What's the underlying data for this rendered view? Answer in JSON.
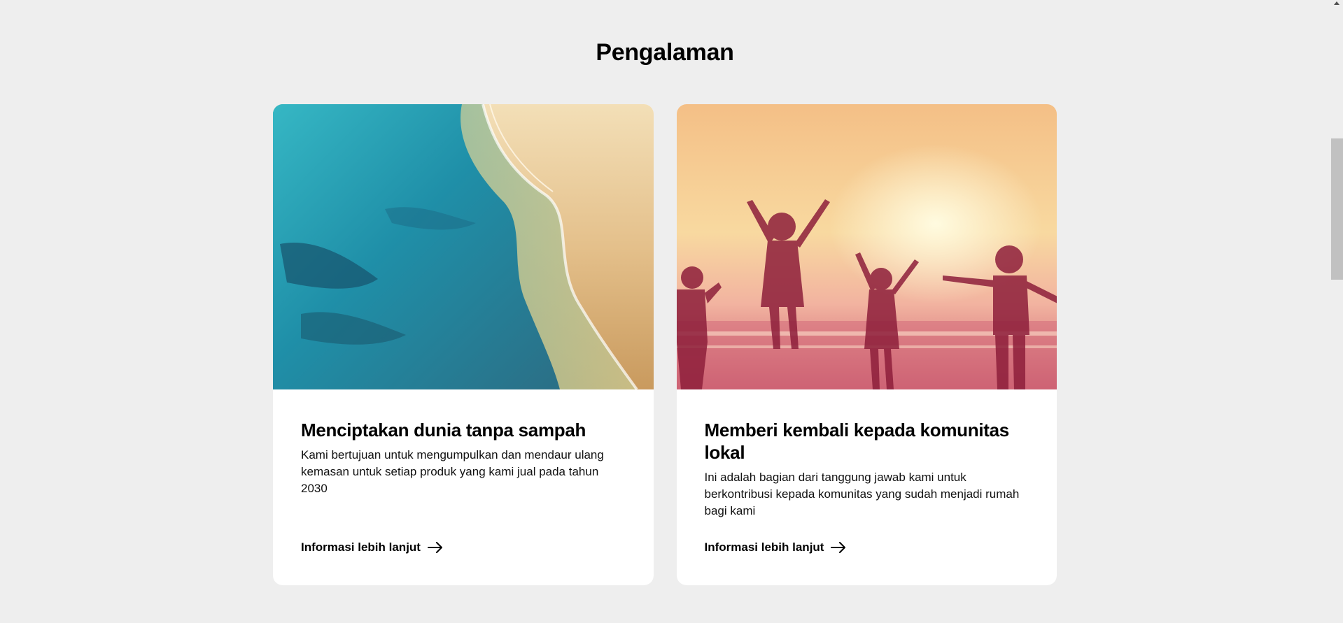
{
  "section": {
    "title": "Pengalaman"
  },
  "cards": [
    {
      "image": "beach-shoreline-image",
      "title": "Menciptakan dunia tanpa sampah",
      "text": "Kami bertujuan untuk mengumpulkan dan mendaur ulang kemasan untuk setiap produk yang kami jual pada tahun 2030",
      "link": "Informasi lebih lanjut",
      "link_icon": "arrow-right-icon"
    },
    {
      "image": "children-jumping-sunset-image",
      "title": "Memberi kembali kepada komunitas lokal",
      "text": "Ini adalah bagian dari tanggung jawab kami untuk berkontribusi kepada komunitas yang sudah menjadi rumah bagi kami",
      "link": "Informasi lebih lanjut",
      "link_icon": "arrow-right-icon"
    }
  ],
  "colors": {
    "background": "#eeeeee",
    "card": "#ffffff",
    "text": "#000000"
  }
}
